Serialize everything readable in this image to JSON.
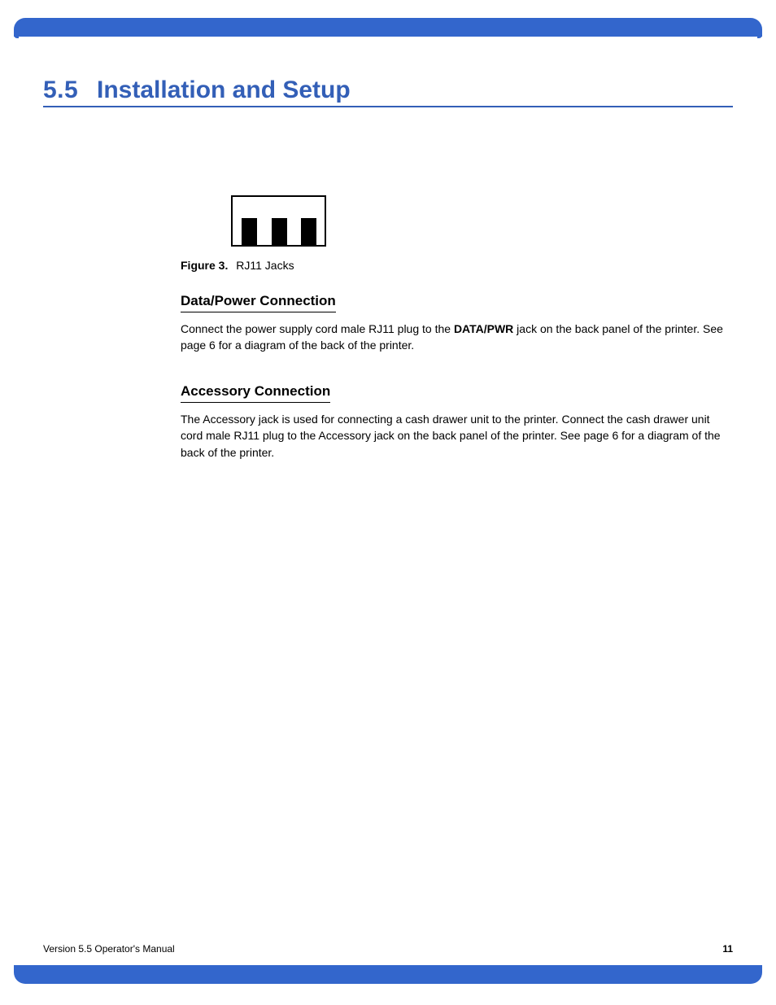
{
  "colors": {
    "accent": "#3366cc",
    "heading": "#335fb7",
    "text": "#000000"
  },
  "header": {
    "section_number": "5.5",
    "title": "Installation and Setup"
  },
  "figure": {
    "label": "Figure 3.",
    "caption": "RJ11 Jacks"
  },
  "sections": {
    "data_power": {
      "heading": "Data/Power Connection",
      "paragraph_pre": "Connect the power supply cord male RJ11 plug to the ",
      "bold": "DATA/PWR",
      "paragraph_post": " jack on the back panel of the printer. See page 6 for a diagram of the back of the printer."
    },
    "accessory": {
      "heading": "Accessory Connection",
      "paragraph": "The Accessory jack is used for connecting a cash drawer unit to the printer. Connect the cash drawer unit cord male RJ11 plug to the Accessory jack on the back panel of the printer. See page 6 for a diagram of the back of the printer."
    }
  },
  "footer": {
    "doc_title": "Version 5.5 Operator's Manual",
    "page_number": "11"
  }
}
